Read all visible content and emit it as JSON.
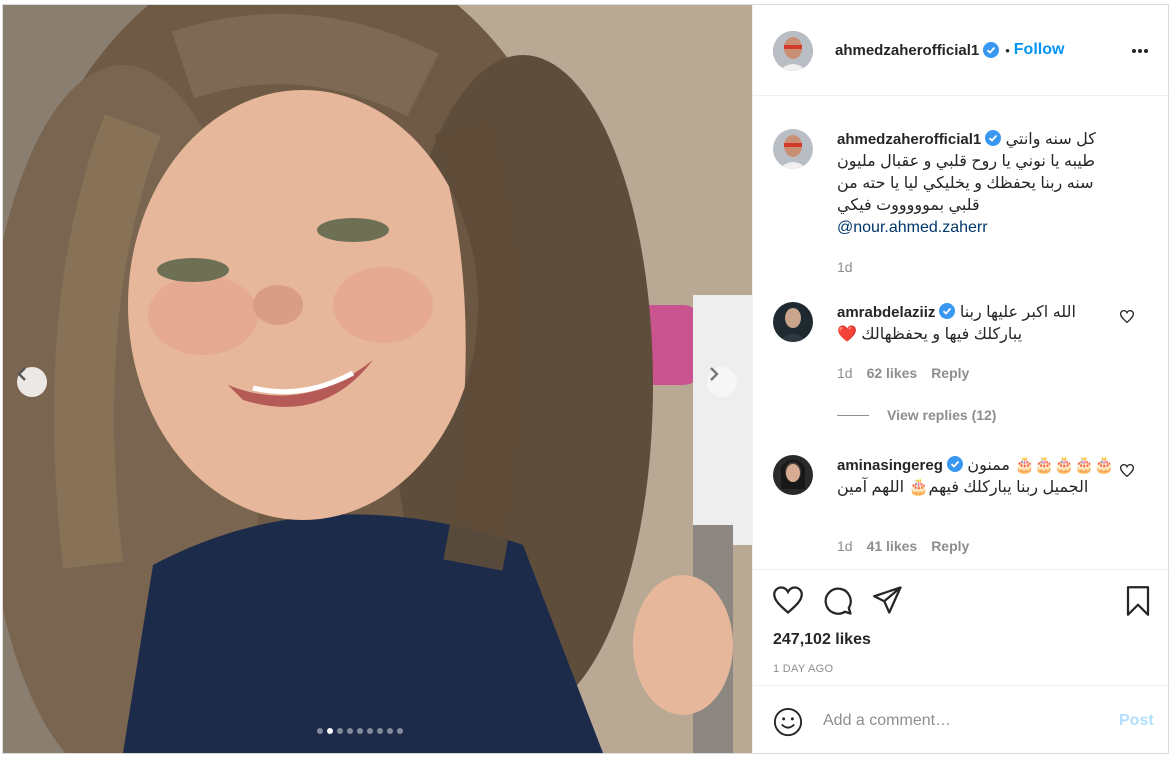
{
  "post": {
    "carousel": {
      "count": 9,
      "active_index": 1,
      "prev_label": "Previous",
      "next_label": "Next"
    },
    "header": {
      "username": "ahmedzaherofficial1",
      "separator": "•",
      "follow_label": "Follow"
    },
    "caption": {
      "username": "ahmedzaherofficial1",
      "text": "كل سنه وانتي طيبه يا نوني يا روح قلبي و عقبال مليون سنه ربنا يحفظك و يخليكي ليا يا حته من قلبي بموووووت فيكي",
      "mention": "@nour.ahmed.zaherr",
      "time": "1d"
    },
    "comments": [
      {
        "username": "amrabdelaziiz",
        "text": "الله اكبر عليها ربنا يباركلك فيها و يحفظهالك ❤️",
        "time": "1d",
        "likes": "62 likes",
        "reply_label": "Reply",
        "view_replies": "View replies (12)"
      },
      {
        "username": "aminasingereg",
        "text": "🎂🎂🎂🎂🎂 ممنون الجميل ربنا يباركلك فيهم🎂 اللهم آمين",
        "time": "1d",
        "likes": "41 likes",
        "reply_label": "Reply"
      }
    ],
    "likes": "247,102 likes",
    "timestamp": "1 DAY AGO",
    "add_comment": {
      "placeholder": "Add a comment…",
      "post_label": "Post"
    }
  },
  "colors": {
    "accent": "#0095f6",
    "verified": "#3897f0",
    "text": "#262626",
    "muted": "#8e8e8e"
  }
}
